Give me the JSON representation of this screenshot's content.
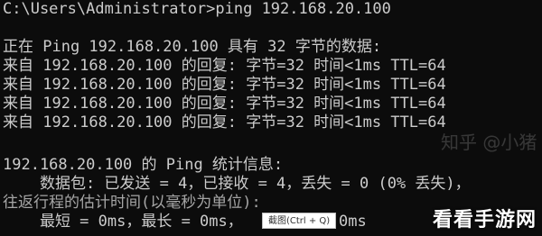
{
  "console": {
    "lines": [
      "C:\\Users\\Administrator>ping 192.168.20.100",
      "",
      "正在 Ping 192.168.20.100 具有 32 字节的数据:",
      "来自 192.168.20.100 的回复: 字节=32 时间<1ms TTL=64",
      "来自 192.168.20.100 的回复: 字节=32 时间<1ms TTL=64",
      "来自 192.168.20.100 的回复: 字节=32 时间<1ms TTL=64",
      "来自 192.168.20.100 的回复: 字节=32 时间<1ms TTL=64",
      "",
      "192.168.20.100 的 Ping 统计信息:",
      "    数据包: 已发送 = 4，已接收 = 4，丢失 = 0 (0% 丢失)，",
      "往返行程的估计时间(以毫秒为单位):",
      "    最短 = 0ms，最长 = 0ms，"
    ],
    "partial_tail": "0ms"
  },
  "tooltip": {
    "label": "截图(Ctrl + Q)"
  },
  "watermark": {
    "brand": "看看手游网",
    "faint": "知乎 @小猪"
  },
  "colors": {
    "background": "#0c0c0c",
    "text": "#cccccc"
  }
}
